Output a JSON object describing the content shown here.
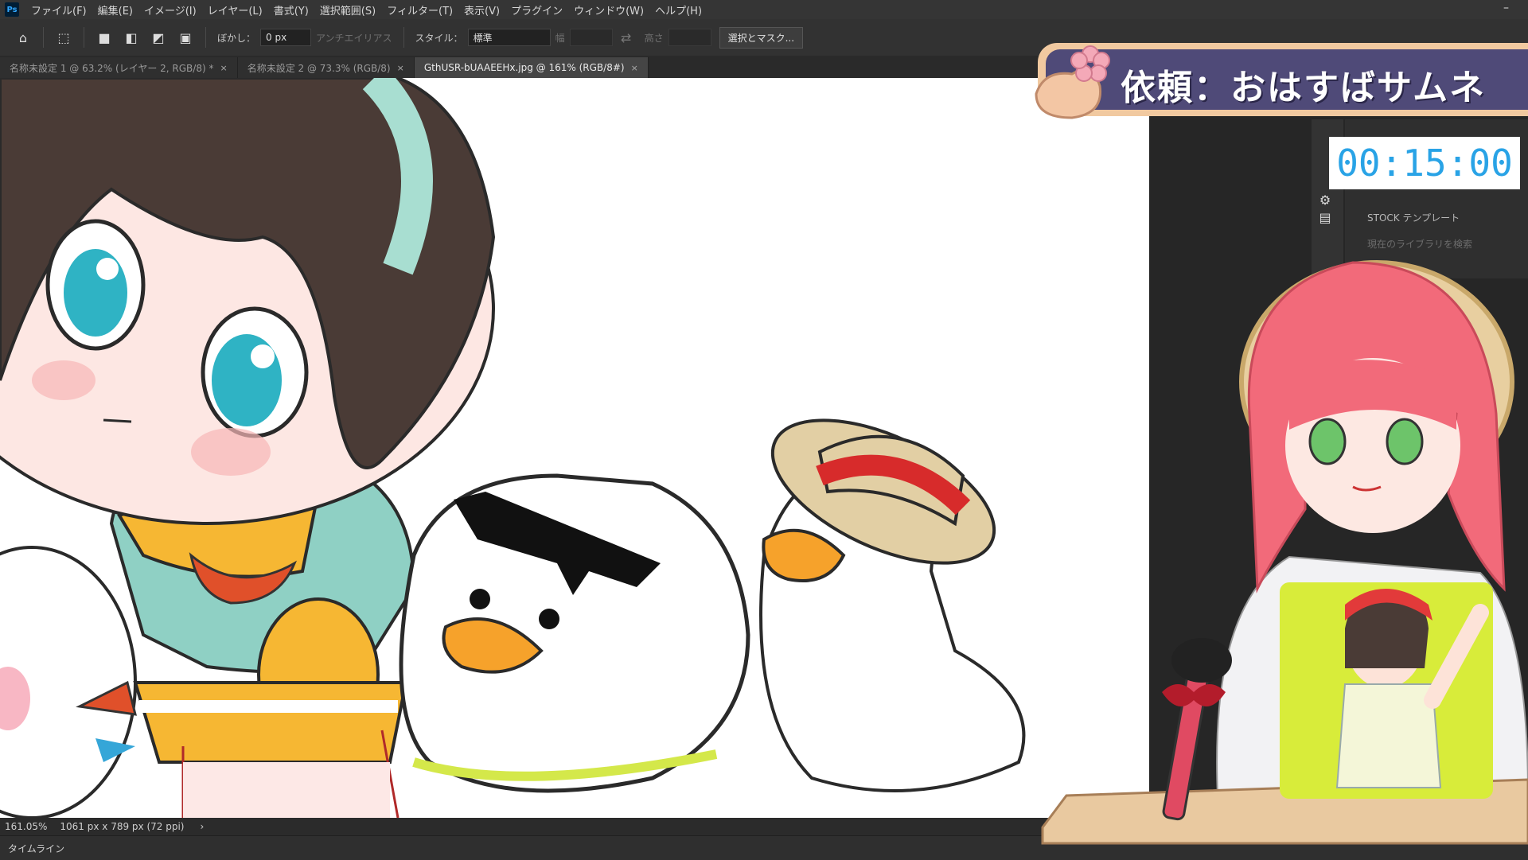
{
  "app": {
    "logo_text": "Ps"
  },
  "menu": {
    "items": [
      "ファイル(F)",
      "編集(E)",
      "イメージ(I)",
      "レイヤー(L)",
      "書式(Y)",
      "選択範囲(S)",
      "フィルター(T)",
      "表示(V)",
      "プラグイン",
      "ウィンドウ(W)",
      "ヘルプ(H)"
    ]
  },
  "options": {
    "feather_label": "ぼかし：",
    "feather_value": "0 px",
    "antialias_label": "アンチエイリアス",
    "style_label": "スタイル：",
    "style_value": "標準",
    "width_label": "幅",
    "height_label": "高さ",
    "select_mask_label": "選択とマスク..."
  },
  "tabs": [
    {
      "label": "名称未設定 1 @ 63.2% (レイヤー 2, RGB/8) *",
      "active": false
    },
    {
      "label": "名称未設定 2 @ 73.3% (RGB/8)",
      "active": false
    },
    {
      "label": "GthUSR-bUAAEEHx.jpg @ 161% (RGB/8#)",
      "active": true
    }
  ],
  "status": {
    "zoom": "161.05%",
    "doc_info": "1061 px x 789 px (72 ppi)"
  },
  "timeline": {
    "label": "タイムライン"
  },
  "panel": {
    "stock_label": "STOCK テンプレート",
    "search_placeholder": "現在のライブラリを検索"
  },
  "overlay": {
    "request_title": "依頼：おはすばサムネ",
    "timer": "00:15:00"
  },
  "colors": {
    "accent_timer": "#29a3e6",
    "banner_bg": "#4f4a78",
    "banner_frame": "#f1c9a0"
  }
}
